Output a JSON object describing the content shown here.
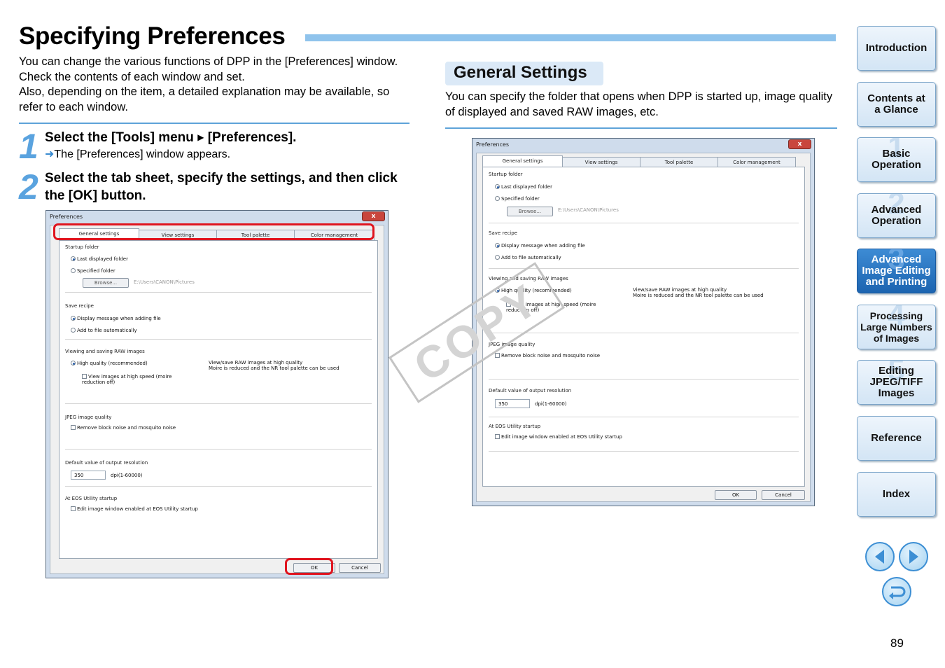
{
  "page": {
    "title": "Specifying Preferences",
    "intro": "You can change the various functions of DPP in the [Preferences] window. Check the contents of each window and set.\nAlso, depending on the item, a detailed explanation may be available, so refer to each window.",
    "page_number": "89",
    "watermark": "COPY"
  },
  "steps": [
    {
      "number": "1",
      "text_before": "Select the [Tools] menu ",
      "arrow": "▶",
      "text_after": " [Preferences].",
      "sub_arrow": "➜",
      "sub": "The [Preferences] window appears."
    },
    {
      "number": "2",
      "text": "Select the tab sheet, specify the settings, and then click the [OK] button."
    }
  ],
  "section": {
    "heading": "General Settings",
    "desc": "You can specify the folder that opens when DPP is started up, image quality of displayed and saved RAW images, etc."
  },
  "dialog": {
    "title": "Preferences",
    "close": "x",
    "tabs": [
      "General settings",
      "View settings",
      "Tool palette",
      "Color management"
    ],
    "startup_folder": {
      "label": "Startup folder",
      "last": "Last displayed folder",
      "specified": "Specified folder",
      "browse": "Browse...",
      "path": "E:\\Users\\CANON\\Pictures"
    },
    "save_recipe": {
      "label": "Save recipe",
      "display": "Display message when adding file",
      "add": "Add to file automatically"
    },
    "raw": {
      "label": "Viewing and saving RAW images",
      "high": "High quality (recommended)",
      "high_desc": "View/save RAW images at high quality\nMoire is reduced and the NR tool palette can be used",
      "fast": "View images at high speed (moire reduction off)"
    },
    "jpeg": {
      "label": "JPEG image quality",
      "remove": "Remove block noise and mosquito noise"
    },
    "resolution": {
      "label": "Default value of output resolution",
      "value": "350",
      "unit": "dpi(1-60000)"
    },
    "eos": {
      "label": "At EOS Utility startup",
      "edit": "Edit image window enabled at EOS Utility startup"
    },
    "ok": "OK",
    "cancel": "Cancel"
  },
  "nav": [
    {
      "label": "Introduction",
      "num": ""
    },
    {
      "label": "Contents at a Glance",
      "num": ""
    },
    {
      "label": "Basic Operation",
      "num": "1"
    },
    {
      "label": "Advanced Operation",
      "num": "2"
    },
    {
      "label": "Advanced Image Editing and Printing",
      "num": "3"
    },
    {
      "label": "Processing Large Numbers of Images",
      "num": "4"
    },
    {
      "label": "Editing JPEG/TIFF Images",
      "num": "5"
    },
    {
      "label": "Reference",
      "num": ""
    },
    {
      "label": "Index",
      "num": ""
    }
  ],
  "colors": {
    "accent": "#5aa3df",
    "title_bar": "#8fc3ec",
    "highlight": "#e0141e",
    "nav_active": "#1c64b0"
  }
}
